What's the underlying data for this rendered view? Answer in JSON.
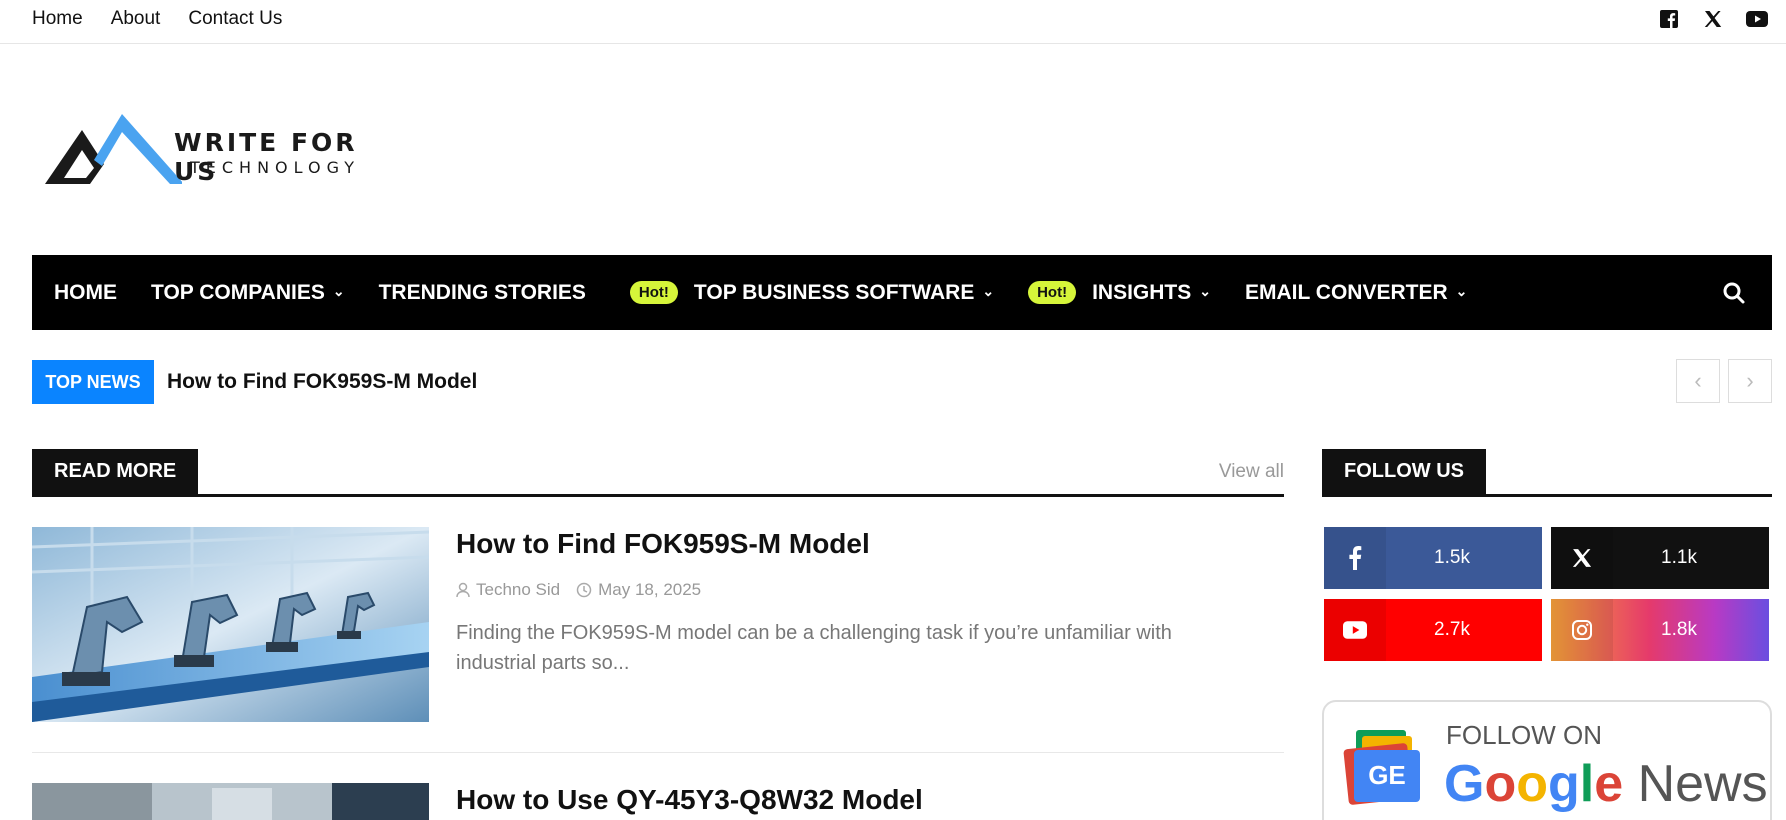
{
  "topnav": {
    "home": "Home",
    "about": "About",
    "contact": "Contact Us"
  },
  "social_icons": [
    "facebook-icon",
    "x-icon",
    "youtube-icon"
  ],
  "logo": {
    "line1": "WRITE FOR US",
    "line2": "TECHNOLOGY"
  },
  "mainnav": {
    "items": [
      "HOME",
      "TOP COMPANIES",
      "TRENDING STORIES",
      "TOP BUSINESS SOFTWARE",
      "INSIGHTS",
      "EMAIL CONVERTER"
    ],
    "hot_badge": "Hot!"
  },
  "topnews": {
    "label": "TOP NEWS",
    "headline": "How to Find FOK959S-M Model"
  },
  "readmore": {
    "label": "READ MORE",
    "view_all": "View all"
  },
  "articles": [
    {
      "title": "How to Find FOK959S-M Model",
      "author": "Techno Sid",
      "date": "May 18, 2025",
      "excerpt": "Finding the FOK959S-M model can be a challenging task if you’re unfamiliar with industrial parts so..."
    },
    {
      "title": "How to Use QY-45Y3-Q8W32 Model"
    }
  ],
  "follow": {
    "label": "FOLLOW US",
    "facebook": "1.5k",
    "x": "1.1k",
    "youtube": "2.7k",
    "instagram": "1.8k"
  },
  "gnews": {
    "follow_on": "FOLLOW ON",
    "google": "Google",
    "news": "News",
    "badge": "GE"
  },
  "colors": {
    "accent": "#0a84ff",
    "hot": "#d6f53a",
    "facebook": "#3b5998",
    "youtube": "#ff0000",
    "x": "#111111"
  }
}
